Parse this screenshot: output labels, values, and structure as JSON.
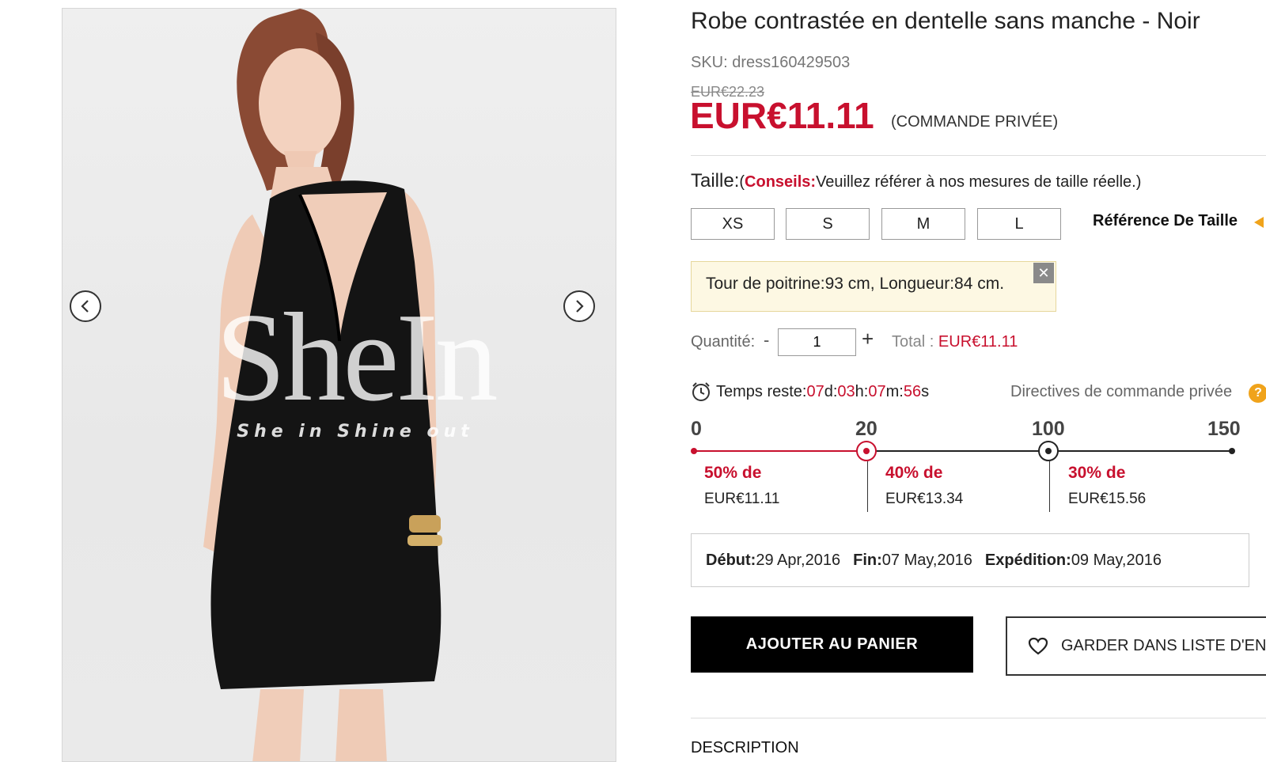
{
  "product": {
    "title": "Robe contrastée en dentelle sans manche - Noir",
    "sku": "SKU: dress160429503",
    "old_price": "EUR€22.23",
    "price": "EUR€11.11",
    "price_note": "(COMMANDE PRIVÉE)"
  },
  "image": {
    "watermark": "SheIn",
    "watermark_tagline": "She in   Shine out",
    "prev_icon": "chevron-left-icon",
    "next_icon": "chevron-right-icon"
  },
  "size": {
    "label": "Taille:",
    "tip_open": "(",
    "tip_key": "Conseils:",
    "tip_text": "Veuillez référer à nos mesures de taille réelle.)",
    "options": [
      "XS",
      "S",
      "M",
      "L"
    ],
    "reference": "Référence De Taille",
    "measurement": "Tour de poitrine:93 cm, Longueur:84 cm.",
    "close_symbol": "✕"
  },
  "quantity": {
    "label": "Quantité:",
    "minus": "-",
    "value": "1",
    "plus": "+",
    "total_label": "Total :",
    "total_value": "EUR€11.11"
  },
  "timer": {
    "label": "Temps reste:",
    "days": "07",
    "d": "d:",
    "hours": "03",
    "h": "h:",
    "minutes": "07",
    "m": "m:",
    "seconds": "56",
    "s": "s",
    "guide": "Directives de commande privée",
    "guide_icon": "?"
  },
  "tiers": {
    "thresholds": [
      "0",
      "20",
      "100",
      "150"
    ],
    "discounts": [
      {
        "label": "50% de",
        "price": "EUR€11.11"
      },
      {
        "label": "40% de",
        "price": "EUR€13.34"
      },
      {
        "label": "30% de",
        "price": "EUR€15.56"
      }
    ]
  },
  "dates": {
    "start_label": "Début:",
    "start": "29 Apr,2016",
    "end_label": "Fin:",
    "end": "07 May,2016",
    "ship_label": "Expédition:",
    "ship": "09 May,2016"
  },
  "actions": {
    "cart": "AJOUTER AU PANIER",
    "wishlist": "GARDER DANS LISTE D'ENV"
  },
  "description_title": "DESCRIPTION",
  "colors": {
    "accent_red": "#c8102e",
    "accent_orange": "#f0a31b",
    "button_black": "#000000",
    "notice_bg": "#fdf8e3"
  }
}
